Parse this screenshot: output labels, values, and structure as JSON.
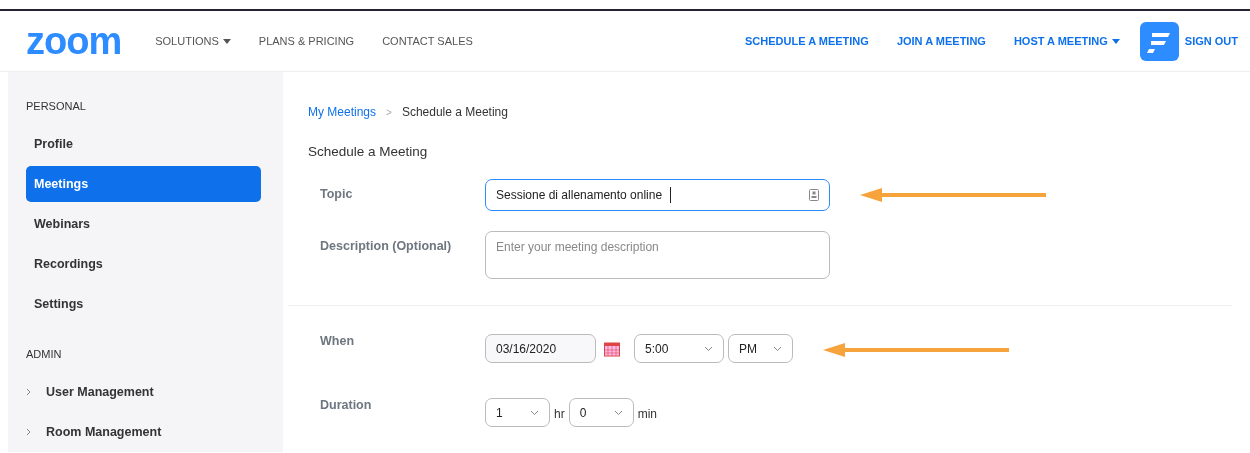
{
  "header": {
    "logo": "zoom",
    "nav_left": [
      {
        "label": "SOLUTIONS",
        "dropdown": true
      },
      {
        "label": "PLANS & PRICING",
        "dropdown": false
      },
      {
        "label": "CONTACT SALES",
        "dropdown": false
      }
    ],
    "nav_right": [
      {
        "label": "SCHEDULE A MEETING",
        "dropdown": false
      },
      {
        "label": "JOIN A MEETING",
        "dropdown": false
      },
      {
        "label": "HOST A MEETING",
        "dropdown": true
      }
    ],
    "sign_out": "SIGN OUT"
  },
  "sidebar": {
    "sections": [
      {
        "title": "PERSONAL",
        "items": [
          {
            "label": "Profile",
            "selected": false,
            "expandable": false
          },
          {
            "label": "Meetings",
            "selected": true,
            "expandable": false
          },
          {
            "label": "Webinars",
            "selected": false,
            "expandable": false
          },
          {
            "label": "Recordings",
            "selected": false,
            "expandable": false
          },
          {
            "label": "Settings",
            "selected": false,
            "expandable": false
          }
        ]
      },
      {
        "title": "ADMIN",
        "items": [
          {
            "label": "User Management",
            "selected": false,
            "expandable": true
          },
          {
            "label": "Room Management",
            "selected": false,
            "expandable": true
          }
        ]
      }
    ]
  },
  "breadcrumb": {
    "link": "My Meetings",
    "separator": ">",
    "current": "Schedule a Meeting"
  },
  "heading": "Schedule a Meeting",
  "form": {
    "topic": {
      "label": "Topic",
      "value": "Sessione di allenamento online"
    },
    "description": {
      "label": "Description (Optional)",
      "placeholder": "Enter your meeting description"
    },
    "when": {
      "label": "When",
      "date": "03/16/2020",
      "time": "5:00",
      "ampm": "PM"
    },
    "duration": {
      "label": "Duration",
      "hours": "1",
      "hours_unit": "hr",
      "minutes": "0",
      "minutes_unit": "min"
    }
  }
}
